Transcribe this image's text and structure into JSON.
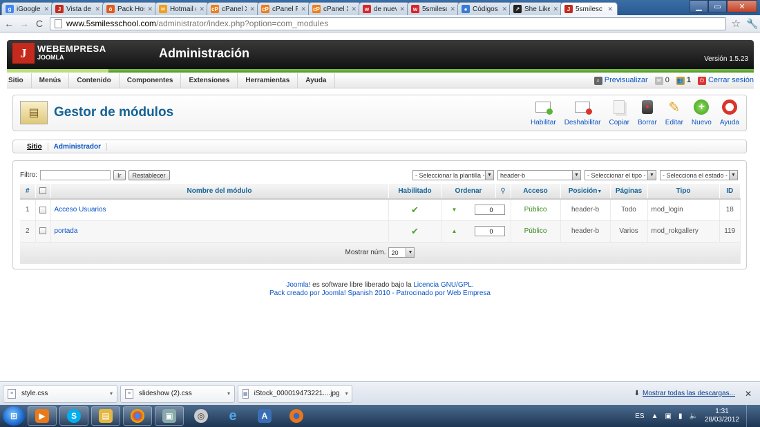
{
  "browser": {
    "tabs": [
      {
        "label": "iGoogle",
        "color": "#4285f4",
        "glyph": "g"
      },
      {
        "label": "Vista de lo",
        "color": "#c62a1d",
        "glyph": "J"
      },
      {
        "label": "Pack Host",
        "color": "#e35a1c",
        "glyph": "ó"
      },
      {
        "label": "Hotmail (",
        "color": "#f0a020",
        "glyph": "✉"
      },
      {
        "label": "cPanel X",
        "color": "#f07e1a",
        "glyph": "cP"
      },
      {
        "label": "cPanel Fil",
        "color": "#f07e1a",
        "glyph": "cP"
      },
      {
        "label": "cPanel X -",
        "color": "#f07e1a",
        "glyph": "cP"
      },
      {
        "label": "de nuevo",
        "color": "#d8262a",
        "glyph": "w"
      },
      {
        "label": "5smilesc",
        "color": "#d8262a",
        "glyph": "w"
      },
      {
        "label": "Códigos c",
        "color": "#3a7bd5",
        "glyph": "●"
      },
      {
        "label": "She Likes",
        "color": "#222222",
        "glyph": "↗"
      },
      {
        "label": "5smilesc",
        "color": "#c62a1d",
        "glyph": "J"
      }
    ],
    "url_host": "www.5smilesschool.com",
    "url_path": "/administrator/index.php?option=com_modules"
  },
  "header": {
    "brand_line1": "WEBEMPRESA",
    "brand_line2": "JOOMLA",
    "title": "Administración",
    "version": "Versión 1.5.23"
  },
  "menu": {
    "items": [
      "Sitio",
      "Menús",
      "Contenido",
      "Componentes",
      "Extensiones",
      "Herramientas",
      "Ayuda"
    ],
    "preview": "Previsualizar",
    "messages_count": "0",
    "users_count": "1",
    "logout": "Cerrar sesión"
  },
  "toolbar": {
    "title": "Gestor de módulos",
    "buttons": [
      {
        "label": "Habilitar",
        "icon": "enable-icon"
      },
      {
        "label": "Deshabilitar",
        "icon": "disable-icon"
      },
      {
        "label": "Copiar",
        "icon": "copy-icon"
      },
      {
        "label": "Borrar",
        "icon": "trash-icon"
      },
      {
        "label": "Editar",
        "icon": "pencil-icon"
      },
      {
        "label": "Nuevo",
        "icon": "plus-icon"
      },
      {
        "label": "Ayuda",
        "icon": "help-icon"
      }
    ]
  },
  "submenu": {
    "items": [
      {
        "label": "Sitio",
        "active": true
      },
      {
        "label": "Administrador",
        "active": false
      }
    ]
  },
  "filters": {
    "label": "Filtro:",
    "value": "",
    "go": "Ir",
    "reset": "Restablecer",
    "template": "- Seleccionar la plantilla -",
    "position": "header-b",
    "type": "- Seleccionar el tipo -",
    "state": "- Selecciona el estado -"
  },
  "table": {
    "headers": {
      "num": "#",
      "name": "Nombre del módulo",
      "enabled": "Habilitado",
      "order": "Ordenar",
      "access": "Acceso",
      "position": "Posición",
      "pages": "Páginas",
      "type": "Tipo",
      "id": "ID"
    },
    "rows": [
      {
        "num": "1",
        "name": "Acceso Usuarios",
        "order": "0",
        "order_arrow": "down",
        "access": "Público",
        "position": "header-b",
        "pages": "Todo",
        "type": "mod_login",
        "id": "18"
      },
      {
        "num": "2",
        "name": "portada",
        "order": "0",
        "order_arrow": "up",
        "access": "Público",
        "position": "header-b",
        "pages": "Varios",
        "type": "mod_rokgallery",
        "id": "119"
      }
    ],
    "show_label": "Mostrar núm.",
    "show_value": "20"
  },
  "footer": {
    "line1_link": "Joomla!",
    "line1_text": " es software libre liberado bajo la ",
    "line1_link2": "Licencia GNU/GPL.",
    "line2": "Pack creado por Joomla! Spanish 2010 - Patrocinado por Web Empresa"
  },
  "downloads": {
    "items": [
      {
        "name": "style.css"
      },
      {
        "name": "slideshow (2).css"
      },
      {
        "name": "iStock_000019473221....jpg"
      }
    ],
    "show_all": "Mostrar todas las descargas..."
  },
  "taskbar": {
    "lang": "ES",
    "time": "1:31",
    "date": "28/03/2012"
  }
}
